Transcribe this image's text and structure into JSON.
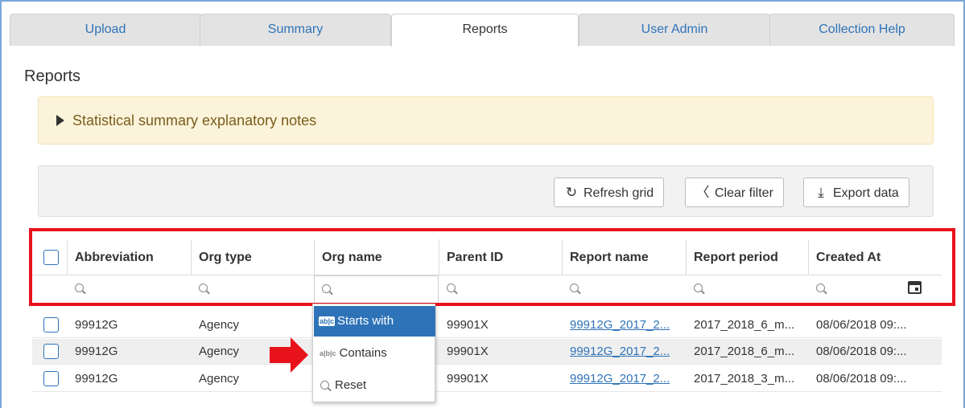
{
  "tabs": [
    {
      "label": "Upload",
      "active": false
    },
    {
      "label": "Summary",
      "active": false
    },
    {
      "label": "Reports",
      "active": true
    },
    {
      "label": "User Admin",
      "active": false
    },
    {
      "label": "Collection Help",
      "active": false
    }
  ],
  "page_title": "Reports",
  "notes": {
    "label": "Statistical summary explanatory notes"
  },
  "toolbar": {
    "refresh_label": "Refresh grid",
    "clear_label": "Clear filter",
    "export_label": "Export data"
  },
  "grid": {
    "columns": [
      "Abbreviation",
      "Org type",
      "Org name",
      "Parent ID",
      "Report name",
      "Report period",
      "Created At"
    ],
    "rows": [
      {
        "abbreviation": "99912G",
        "org_type": "Agency",
        "org_name": "",
        "parent_id": "99901X",
        "report_name": "99912G_2017_2...",
        "report_period": "2017_2018_6_m...",
        "created_at": "08/06/2018 09:..."
      },
      {
        "abbreviation": "99912G",
        "org_type": "Agency",
        "org_name": "",
        "parent_id": "99901X",
        "report_name": "99912G_2017_2...",
        "report_period": "2017_2018_6_m...",
        "created_at": "08/06/2018 09:..."
      },
      {
        "abbreviation": "99912G",
        "org_type": "Agency",
        "org_name": "",
        "parent_id": "99901X",
        "report_name": "99912G_2017_2...",
        "report_period": "2017_2018_3_m...",
        "created_at": "08/06/2018 09:..."
      }
    ]
  },
  "filter_menu": {
    "items": [
      {
        "label": "Starts with",
        "icon": "abc-icon",
        "selected": true
      },
      {
        "label": "Contains",
        "icon": "abc-icon",
        "selected": false
      },
      {
        "label": "Reset",
        "icon": "search-icon",
        "selected": false
      }
    ]
  },
  "colors": {
    "accent": "#2e73b8",
    "highlight_red": "#e8121b",
    "notes_bg": "#fcf4da"
  }
}
